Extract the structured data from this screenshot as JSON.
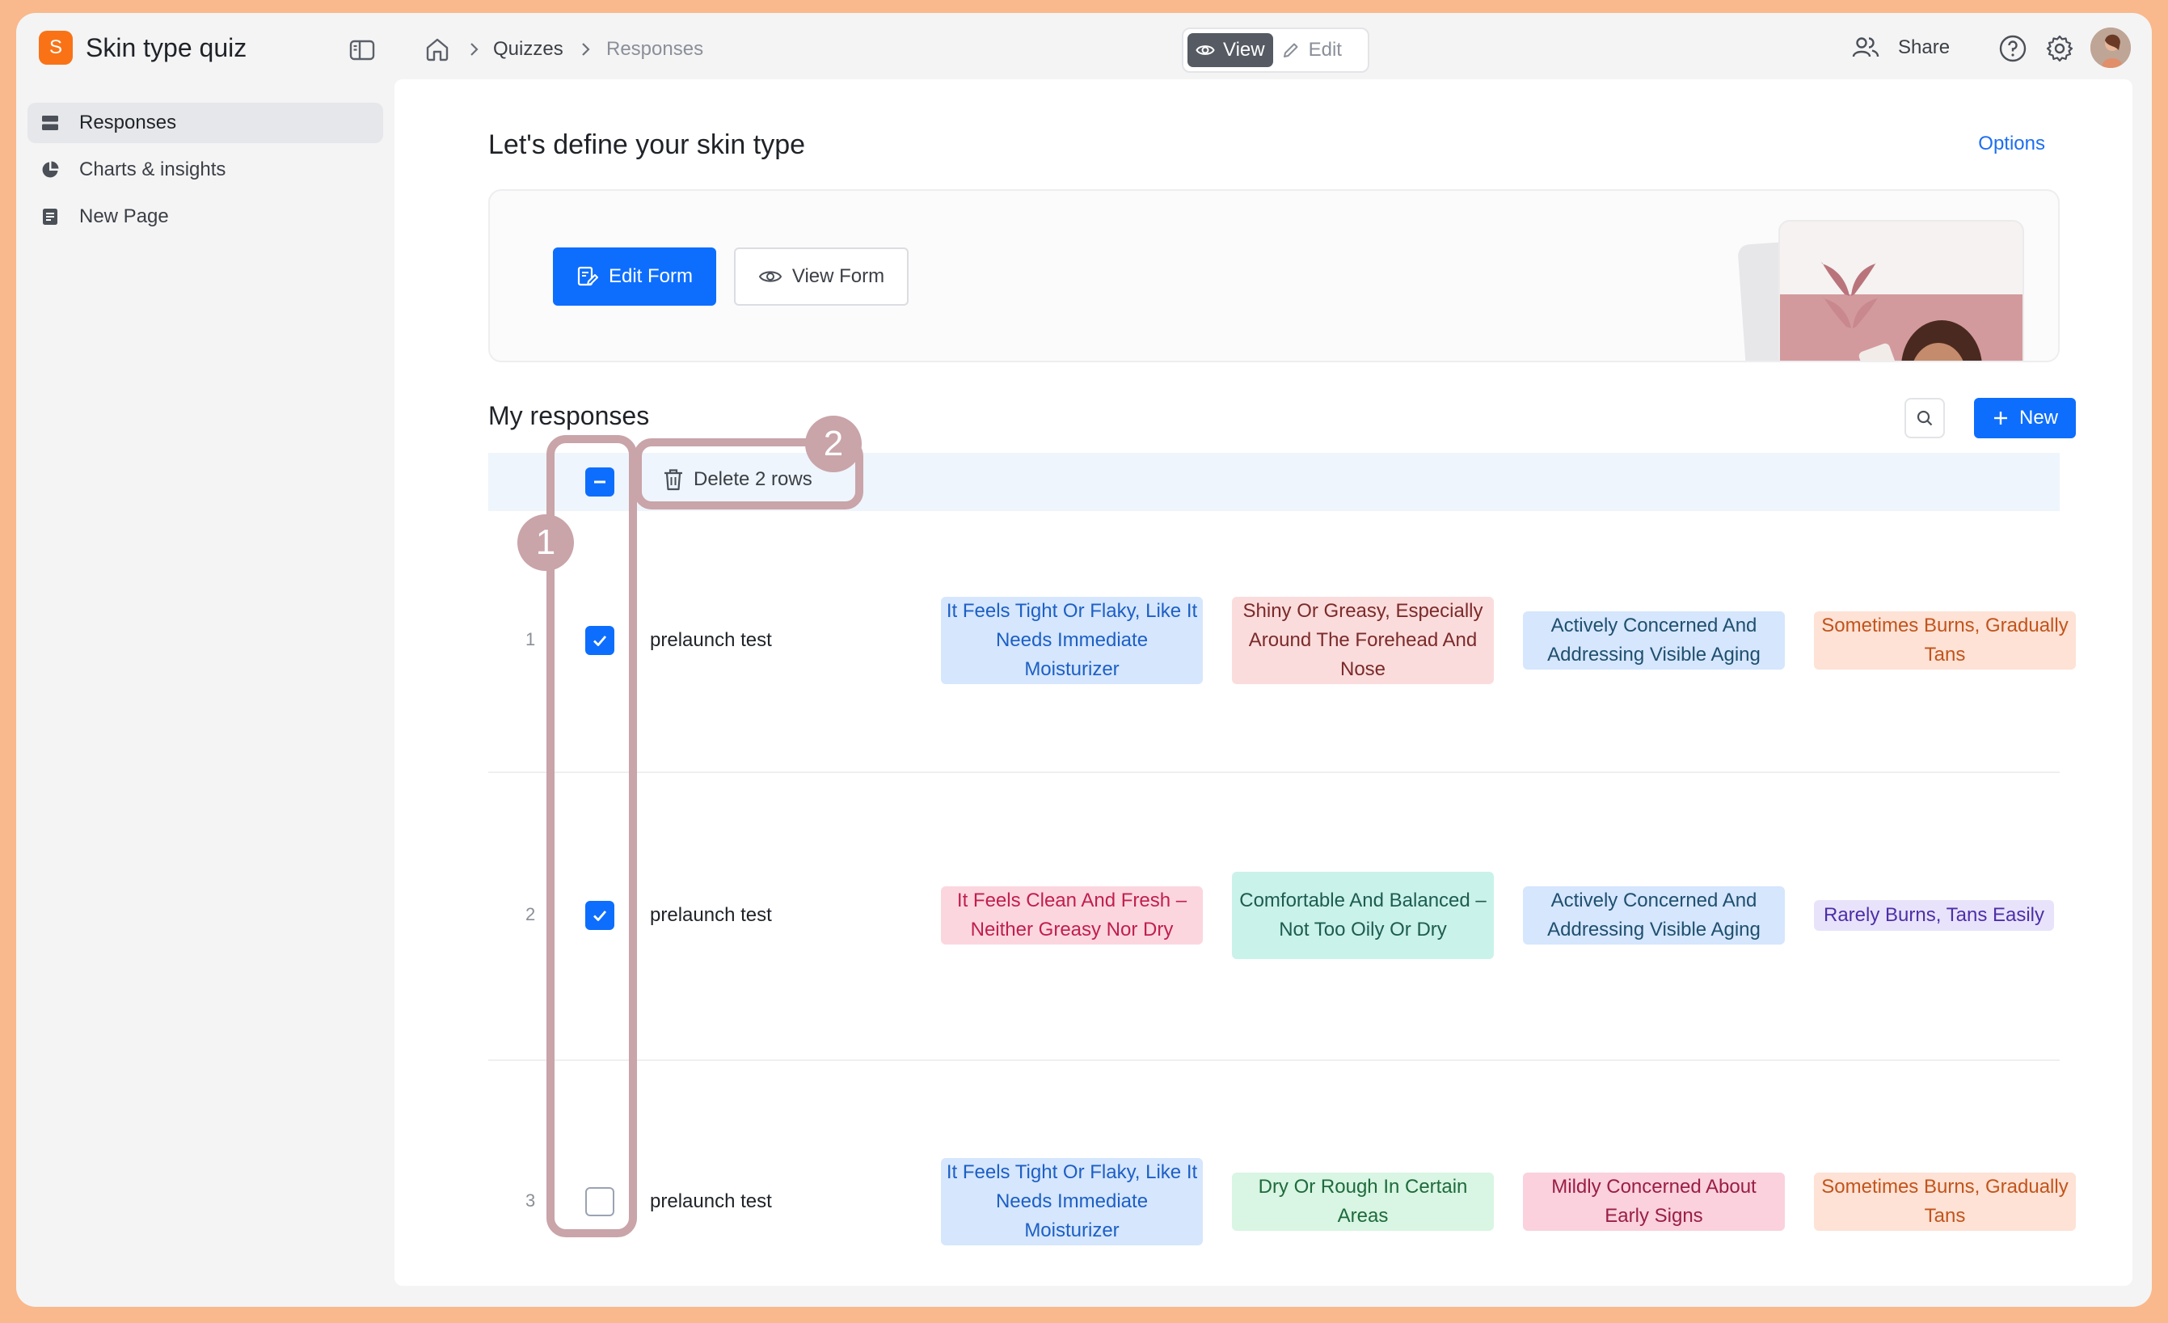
{
  "app": {
    "logo_letter": "S",
    "title": "Skin type quiz"
  },
  "sidebar": {
    "items": [
      {
        "label": "Responses",
        "icon": "table-icon",
        "active": true
      },
      {
        "label": "Charts & insights",
        "icon": "pie-chart-icon",
        "active": false
      },
      {
        "label": "New Page",
        "icon": "document-icon",
        "active": false
      }
    ]
  },
  "breadcrumb": {
    "items": [
      "Quizzes",
      "Responses"
    ]
  },
  "mode": {
    "view": "View",
    "edit": "Edit",
    "active": "view"
  },
  "header": {
    "share": "Share"
  },
  "page": {
    "title": "Let's define your skin type",
    "options": "Options",
    "edit_form": "Edit Form",
    "view_form": "View Form"
  },
  "responses": {
    "title": "My responses",
    "new_button": "New",
    "delete_label": "Delete 2 rows",
    "rows": [
      {
        "num": "1",
        "name": "prelaunch test",
        "checked": true,
        "tags": [
          "It Feels Tight Or Flaky, Like It Needs Immediate Moisturizer",
          "Shiny Or Greasy, Especially Around The Forehead And Nose",
          "Actively Concerned And Addressing Visible Aging",
          "Sometimes Burns, Gradually Tans"
        ]
      },
      {
        "num": "2",
        "name": "prelaunch test",
        "checked": true,
        "tags": [
          "It Feels Clean And Fresh – Neither Greasy Nor Dry",
          "Comfortable And Balanced – Not Too Oily Or Dry",
          "Actively Concerned And Addressing Visible Aging",
          "Rarely Burns, Tans Easily"
        ]
      },
      {
        "num": "3",
        "name": "prelaunch test",
        "checked": false,
        "tags": [
          "It Feels Tight Or Flaky, Like It Needs Immediate Moisturizer",
          "Dry Or Rough In Certain Areas",
          "Mildly Concerned About Early Signs",
          "Sometimes Burns, Gradually Tans"
        ]
      }
    ]
  },
  "annotations": [
    "1",
    "2"
  ],
  "colors": {
    "accent": "#0d6efd",
    "brand": "#f97316",
    "annotation": "#c9a4a9",
    "frame": "#f9b98c"
  }
}
